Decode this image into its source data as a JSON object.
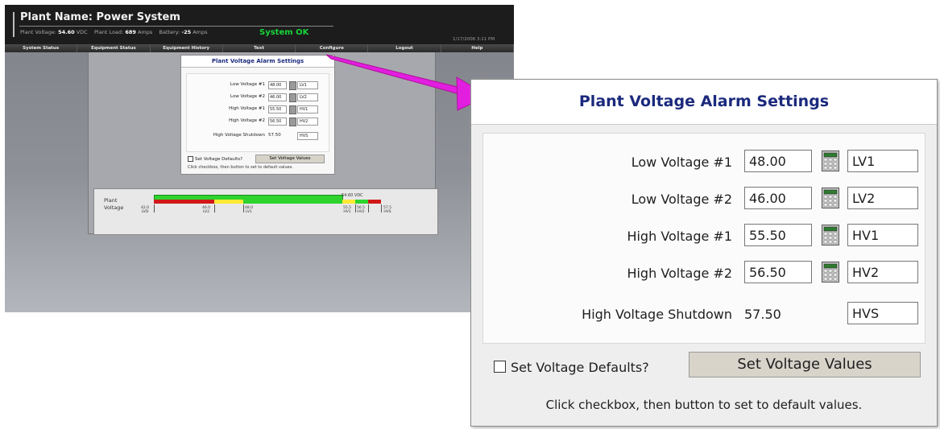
{
  "app": {
    "plant_name": "Plant Name:  Power System",
    "stats": {
      "voltage_label": "Plant Voltage:",
      "voltage_value": "54.60",
      "voltage_unit": "VDC",
      "load_label": "Plant Load:",
      "load_value": "689",
      "load_unit": "Amps",
      "battery_label": "Battery:",
      "battery_value": "-25",
      "battery_unit": "Amps"
    },
    "status": "System OK",
    "datetime": "1/17/2006 3:11 PM",
    "menu": [
      "System Status",
      "Equipment Status",
      "Equipment History",
      "Text",
      "Configure",
      "Logout",
      "Help"
    ]
  },
  "settings": {
    "title": "Plant Voltage Alarm Settings",
    "rows": [
      {
        "label": "Low Voltage #1",
        "value": "48.00",
        "tag": "LV1"
      },
      {
        "label": "Low Voltage #2",
        "value": "46.00",
        "tag": "LV2"
      },
      {
        "label": "High Voltage #1",
        "value": "55.50",
        "tag": "HV1"
      },
      {
        "label": "High Voltage #2",
        "value": "56.50",
        "tag": "HV2"
      }
    ],
    "shutdown": {
      "label": "High Voltage Shutdown",
      "value": "57.50",
      "tag": "HVS"
    },
    "checkbox_label": "Set Voltage Defaults?",
    "button_label": "Set Voltage Values",
    "hint": "Click checkbox, then button to set to default values."
  },
  "voltage_bar": {
    "label_line1": "Plant",
    "label_line2": "Voltage",
    "reading": "54.60 VDC",
    "ticks": [
      {
        "value": "42.0",
        "tag": "LVD"
      },
      {
        "value": "46.0",
        "tag": "LV2"
      },
      {
        "value": "48.0",
        "tag": "LV1"
      },
      {
        "value": "55.5",
        "tag": "HV1"
      },
      {
        "value": "56.5",
        "tag": "HV2"
      },
      {
        "value": "57.5",
        "tag": "HVS"
      }
    ]
  },
  "colors": {
    "title": "#1b2a7d",
    "status_ok": "#18d43a",
    "arrow": "#e21ee0",
    "bar_green": "#2ed32e",
    "bar_red": "#d01818",
    "bar_yellow": "#ffe936"
  }
}
